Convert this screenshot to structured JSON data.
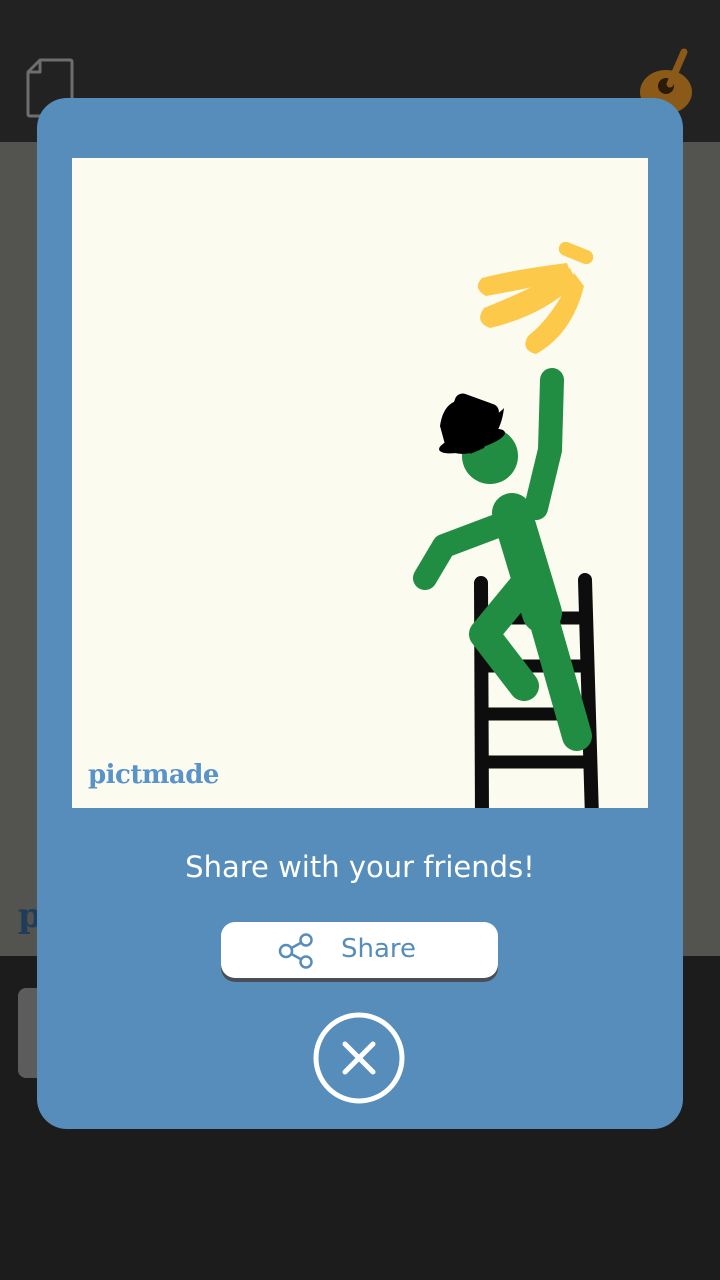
{
  "background": {
    "header": {
      "left_icon": "document-icon",
      "right_icon": "guitar-icon"
    },
    "logo_fragment": "p"
  },
  "modal": {
    "preview": {
      "watermark": "pictmade",
      "illustration": "figure-climbing-ladder-reaching-banana"
    },
    "heading": "Share with your friends!",
    "share_button": {
      "label": "Share",
      "icon": "share-icon"
    },
    "close_button": {
      "icon": "close-icon"
    }
  },
  "colors": {
    "modal_bg": "#568dba",
    "preview_bg": "#fbfbef",
    "figure": "#208d43",
    "banana": "#fcc94a",
    "hat": "#000000",
    "ladder": "#0d0d0d",
    "watermark": "#5a93c8"
  }
}
